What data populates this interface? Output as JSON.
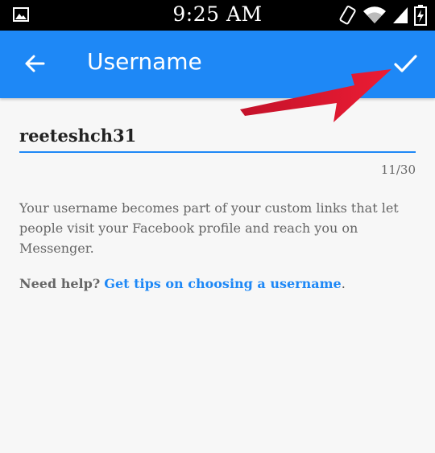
{
  "status_bar": {
    "time": "9:25 AM",
    "icons": [
      "image-icon",
      "vibrate-icon",
      "wifi-icon",
      "signal-icon",
      "battery-charging-icon"
    ]
  },
  "app_bar": {
    "title": "Username",
    "back_icon": "arrow-left-icon",
    "confirm_icon": "check-icon",
    "color": "#1e88f6"
  },
  "form": {
    "username_value": "reeteshch31",
    "char_counter": "11/30",
    "description": "Your username becomes part of your custom links that let people visit your Facebook profile and reach you on Messenger.",
    "help_label": "Need help?",
    "help_link": "Get tips on choosing a username",
    "help_suffix": "."
  },
  "annotation": {
    "red_arrow_icon": "red-arrow-pointer",
    "color": "#e8182e"
  }
}
